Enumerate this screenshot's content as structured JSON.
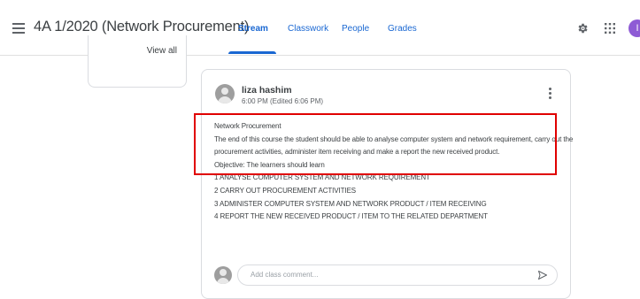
{
  "header": {
    "class_title": "4A 1/2020 (Network Procurement)",
    "tabs": [
      {
        "label": "Stream",
        "active": true
      },
      {
        "label": "Classwork",
        "active": false
      },
      {
        "label": "People",
        "active": false
      },
      {
        "label": "Grades",
        "active": false
      }
    ],
    "account_initial": "I",
    "accent_color": "#1967d2"
  },
  "sidebar": {
    "view_all_label": "View all"
  },
  "post": {
    "author": "liza hashim",
    "timestamp": "6:00 PM (Edited 6:06 PM)",
    "lines": [
      "Network Procurement",
      "The end of this course the student should be able to analyse computer system and network requirement, carry out the",
      "procurement activities, administer item receiving and make a report the new received product.",
      "Objective: The learners should learn",
      "1 ANALYSE COMPUTER SYSTEM AND NETWORK REQUIREMENT",
      "2 CARRY OUT PROCUREMENT ACTIVITIES",
      "3 ADMINISTER COMPUTER SYSTEM AND NETWORK PRODUCT / ITEM RECEIVING",
      "4 REPORT THE NEW RECEIVED PRODUCT / ITEM TO THE RELATED DEPARTMENT"
    ],
    "highlight_color": "#e00000"
  },
  "comment": {
    "placeholder": "Add class comment..."
  },
  "icons": {
    "menu": "menu-icon",
    "settings": "gear-icon",
    "apps": "apps-grid-icon",
    "more": "more-vert-icon",
    "send": "send-icon"
  }
}
